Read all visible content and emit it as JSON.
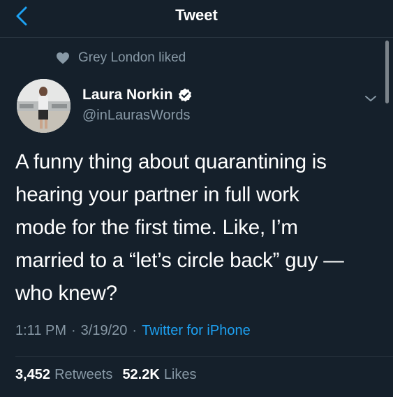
{
  "colors": {
    "background": "#15202b",
    "accent": "#1da1f2",
    "muted": "#8899a6",
    "divider": "#2a3641"
  },
  "nav": {
    "title": "Tweet",
    "back_icon": "chevron-left-icon"
  },
  "social_context": {
    "icon": "heart-icon",
    "text": "Grey London liked"
  },
  "author": {
    "name": "Laura Norkin",
    "handle": "@inLaurasWords",
    "verified_icon": "verified-badge-icon"
  },
  "tweet": {
    "lines": [
      "A funny thing about quarantining is",
      "hearing your partner in full work",
      "mode for the first time. Like, I’m",
      "married to a “let’s circle back” guy —",
      "who knew?"
    ],
    "time": "1:11 PM",
    "date": "3/19/20",
    "source": "Twitter for iPhone",
    "separator": "·"
  },
  "stats": {
    "retweets_count": "3,452",
    "retweets_label": "Retweets",
    "likes_count": "52.2K",
    "likes_label": "Likes"
  }
}
